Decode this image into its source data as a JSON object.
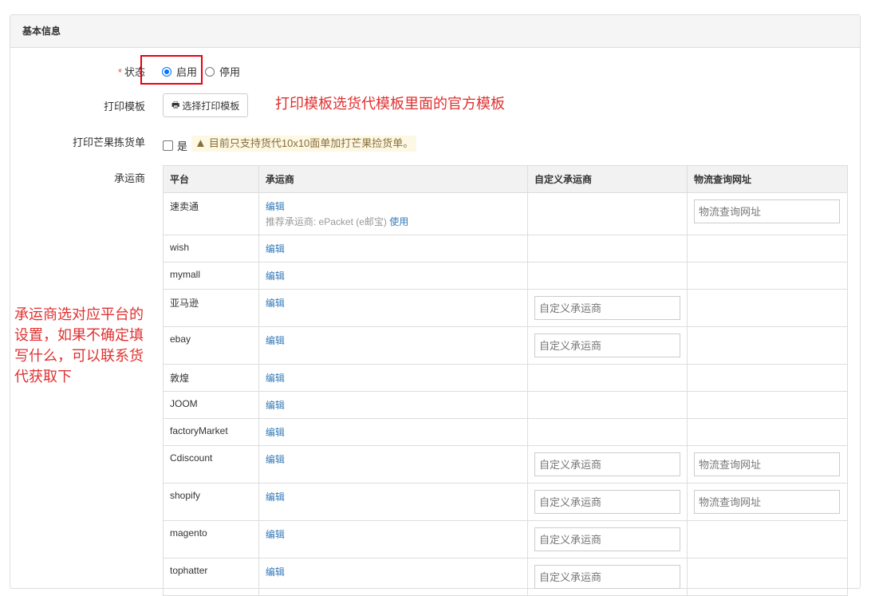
{
  "panel": {
    "title": "基本信息"
  },
  "status": {
    "required_mark": "*",
    "label": "状态",
    "options": [
      {
        "label": "启用",
        "checked": true
      },
      {
        "label": "停用",
        "checked": false
      }
    ]
  },
  "print_template": {
    "label": "打印模板",
    "button_label": "选择打印模板",
    "button_icon": "print-icon"
  },
  "print_mango": {
    "label": "打印芒果拣货单",
    "checkbox_label": "是",
    "warning_icon": "warning-icon",
    "warning_text": "目前只支持货代10x10面单加打芒果捡货单。"
  },
  "carrier": {
    "label": "承运商",
    "columns": [
      "平台",
      "承运商",
      "自定义承运商",
      "物流查询网址"
    ],
    "edit_label": "编辑",
    "recommend_text": "推荐承运商: ePacket (e邮宝)",
    "use_label": "使用",
    "custom_placeholder": "自定义承运商",
    "url_placeholder": "物流查询网址",
    "rows": [
      {
        "platform": "速卖通"
      },
      {
        "platform": "wish"
      },
      {
        "platform": "mymall"
      },
      {
        "platform": "亚马逊"
      },
      {
        "platform": "ebay"
      },
      {
        "platform": "敦煌"
      },
      {
        "platform": "JOOM"
      },
      {
        "platform": "factoryMarket"
      },
      {
        "platform": "Cdiscount"
      },
      {
        "platform": "shopify"
      },
      {
        "platform": "magento"
      },
      {
        "platform": "tophatter"
      }
    ]
  },
  "annotations": {
    "template_note": "打印模板选货代模板里面的官方模板",
    "carrier_note_lines": [
      "承运商选对应平台的",
      "设置，如果不确定填",
      "写什么，可以联系货",
      "代获取下"
    ]
  },
  "colors": {
    "annotation": "#e03030",
    "highlight_box": "#e60012",
    "link": "#337ab7",
    "radio_checked": "#0075ff"
  }
}
